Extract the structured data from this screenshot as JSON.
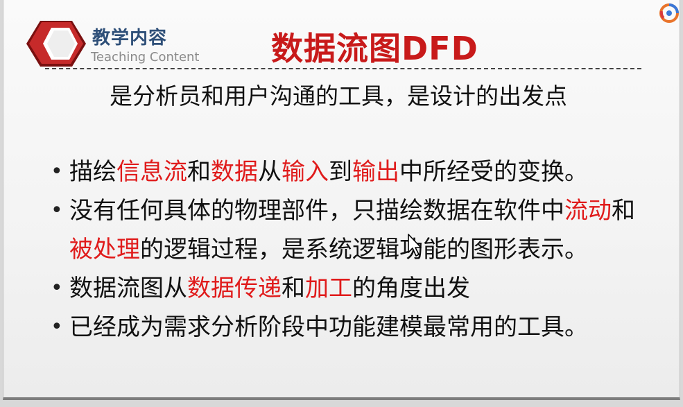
{
  "header": {
    "section_cn": "教学内容",
    "section_en": "Teaching Content",
    "title": "数据流图DFD",
    "subtitle": "是分析员和用户沟通的工具，是设计的出发点"
  },
  "bullets": [
    {
      "segments": [
        {
          "text": "描绘",
          "red": false
        },
        {
          "text": "信息流",
          "red": true
        },
        {
          "text": "和",
          "red": false
        },
        {
          "text": "数据",
          "red": true
        },
        {
          "text": "从",
          "red": false
        },
        {
          "text": "输入",
          "red": true
        },
        {
          "text": "到",
          "red": false
        },
        {
          "text": "输出",
          "red": true
        },
        {
          "text": "中所经受的变换。",
          "red": false
        }
      ]
    },
    {
      "segments": [
        {
          "text": "没有任何具体的物理部件，只描绘数据在软件中",
          "red": false
        },
        {
          "text": "流动",
          "red": true
        },
        {
          "text": "和",
          "red": false
        },
        {
          "text": "被处理",
          "red": true
        },
        {
          "text": "的逻辑过程，是系统逻辑功能的图形表示。",
          "red": false
        }
      ]
    },
    {
      "segments": [
        {
          "text": "数据流图从",
          "red": false
        },
        {
          "text": "数据传递",
          "red": true
        },
        {
          "text": "和",
          "red": false
        },
        {
          "text": "加工",
          "red": true
        },
        {
          "text": "的角度出发",
          "red": false
        }
      ]
    },
    {
      "segments": [
        {
          "text": "已经成为需求分析阶段中功能建模最常用的工具。",
          "red": false
        }
      ]
    }
  ],
  "icons": {
    "badge": "hexagon-badge-icon",
    "logo": "app-logo-icon",
    "cursor": "mouse-cursor-icon"
  },
  "colors": {
    "title_red": "#c81a1a",
    "highlight_red": "#e01b1b",
    "header_blue": "#2e4f78",
    "badge_red": "#c62a2a"
  }
}
